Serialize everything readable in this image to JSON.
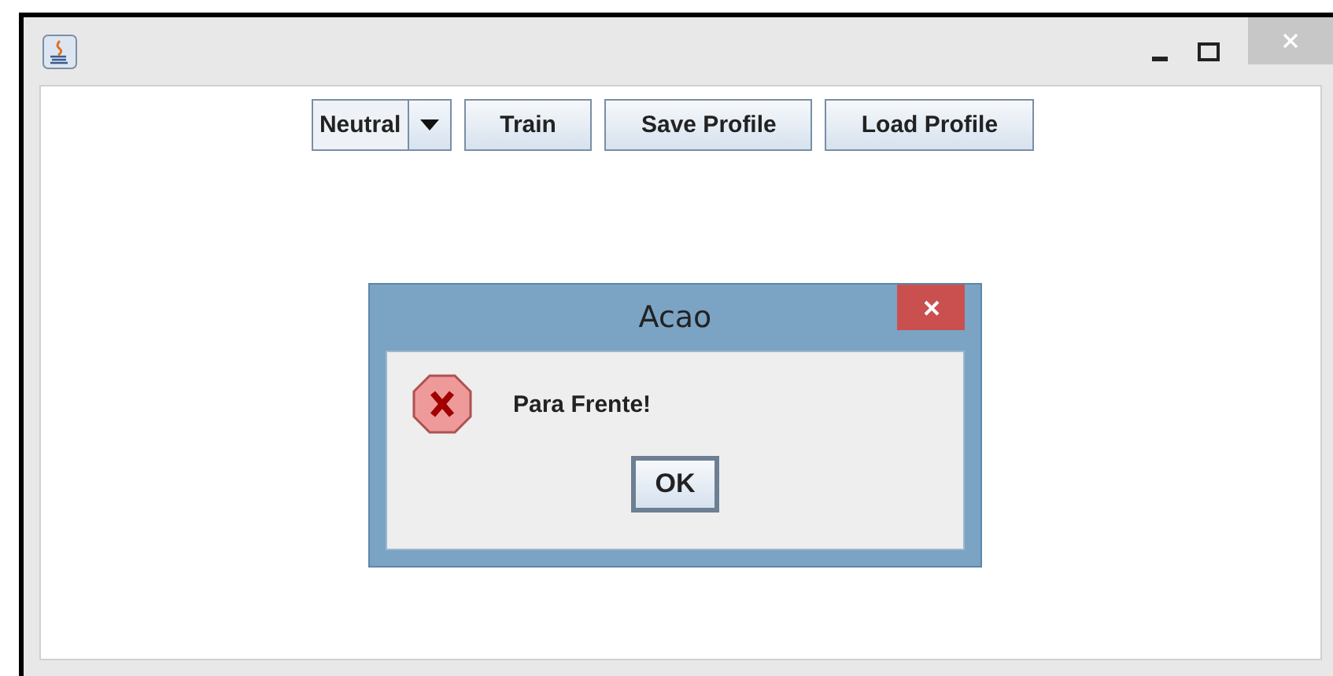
{
  "toolbar": {
    "combo": {
      "value": "Neutral"
    },
    "buttons": [
      "Train",
      "Save Profile",
      "Load Profile"
    ]
  },
  "dialog": {
    "title": "Acao",
    "kind": "error",
    "message": "Para Frente!",
    "buttons": [
      {
        "label": "OK",
        "focused": true
      }
    ]
  }
}
